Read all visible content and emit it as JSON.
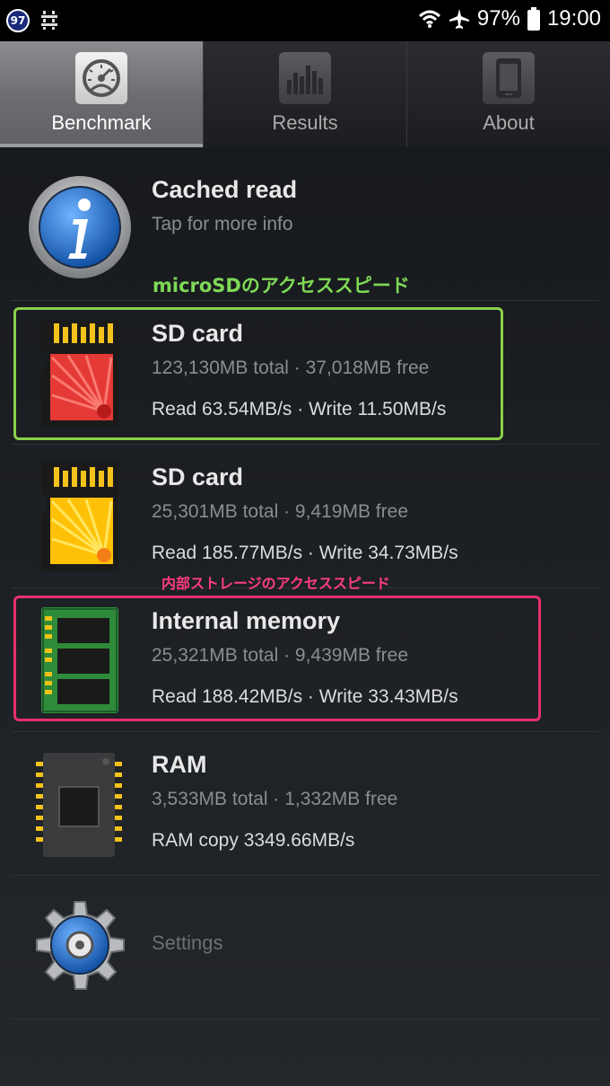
{
  "status_bar": {
    "badge": "97",
    "battery": "97%",
    "time": "19:00",
    "icons": [
      "wifi-icon",
      "airplane-icon",
      "battery-icon"
    ]
  },
  "tabs": [
    {
      "label": "Benchmark",
      "icon": "gauge-icon",
      "active": true
    },
    {
      "label": "Results",
      "icon": "bar-chart-icon",
      "active": false
    },
    {
      "label": "About",
      "icon": "phone-icon",
      "active": false
    }
  ],
  "cached_read": {
    "title": "Cached read",
    "subtitle": "Tap for more info",
    "icon": "info-icon"
  },
  "annotations": {
    "microsd": "microSDのアクセススピード",
    "internal": "内部ストレージのアクセススピード"
  },
  "items": [
    {
      "title": "SD card",
      "subtitle": "123,130MB total · 37,018MB free",
      "speed": "Read 63.54MB/s · Write 11.50MB/s",
      "icon": "sd-card-red-icon"
    },
    {
      "title": "SD card",
      "subtitle": "25,301MB total · 9,419MB free",
      "speed": "Read 185.77MB/s · Write 34.73MB/s",
      "icon": "sd-card-yellow-icon"
    },
    {
      "title": "Internal memory",
      "subtitle": "25,321MB total · 9,439MB free",
      "speed": "Read 188.42MB/s · Write 33.43MB/s",
      "icon": "memory-module-icon"
    },
    {
      "title": "RAM",
      "subtitle": "3,533MB total · 1,332MB free",
      "speed": "RAM copy 3349.66MB/s",
      "icon": "chip-icon"
    }
  ],
  "settings": {
    "label": "Settings",
    "icon": "gear-icon"
  },
  "colors": {
    "annotation_green": "#8ad04a",
    "annotation_pink": "#e8306c"
  }
}
